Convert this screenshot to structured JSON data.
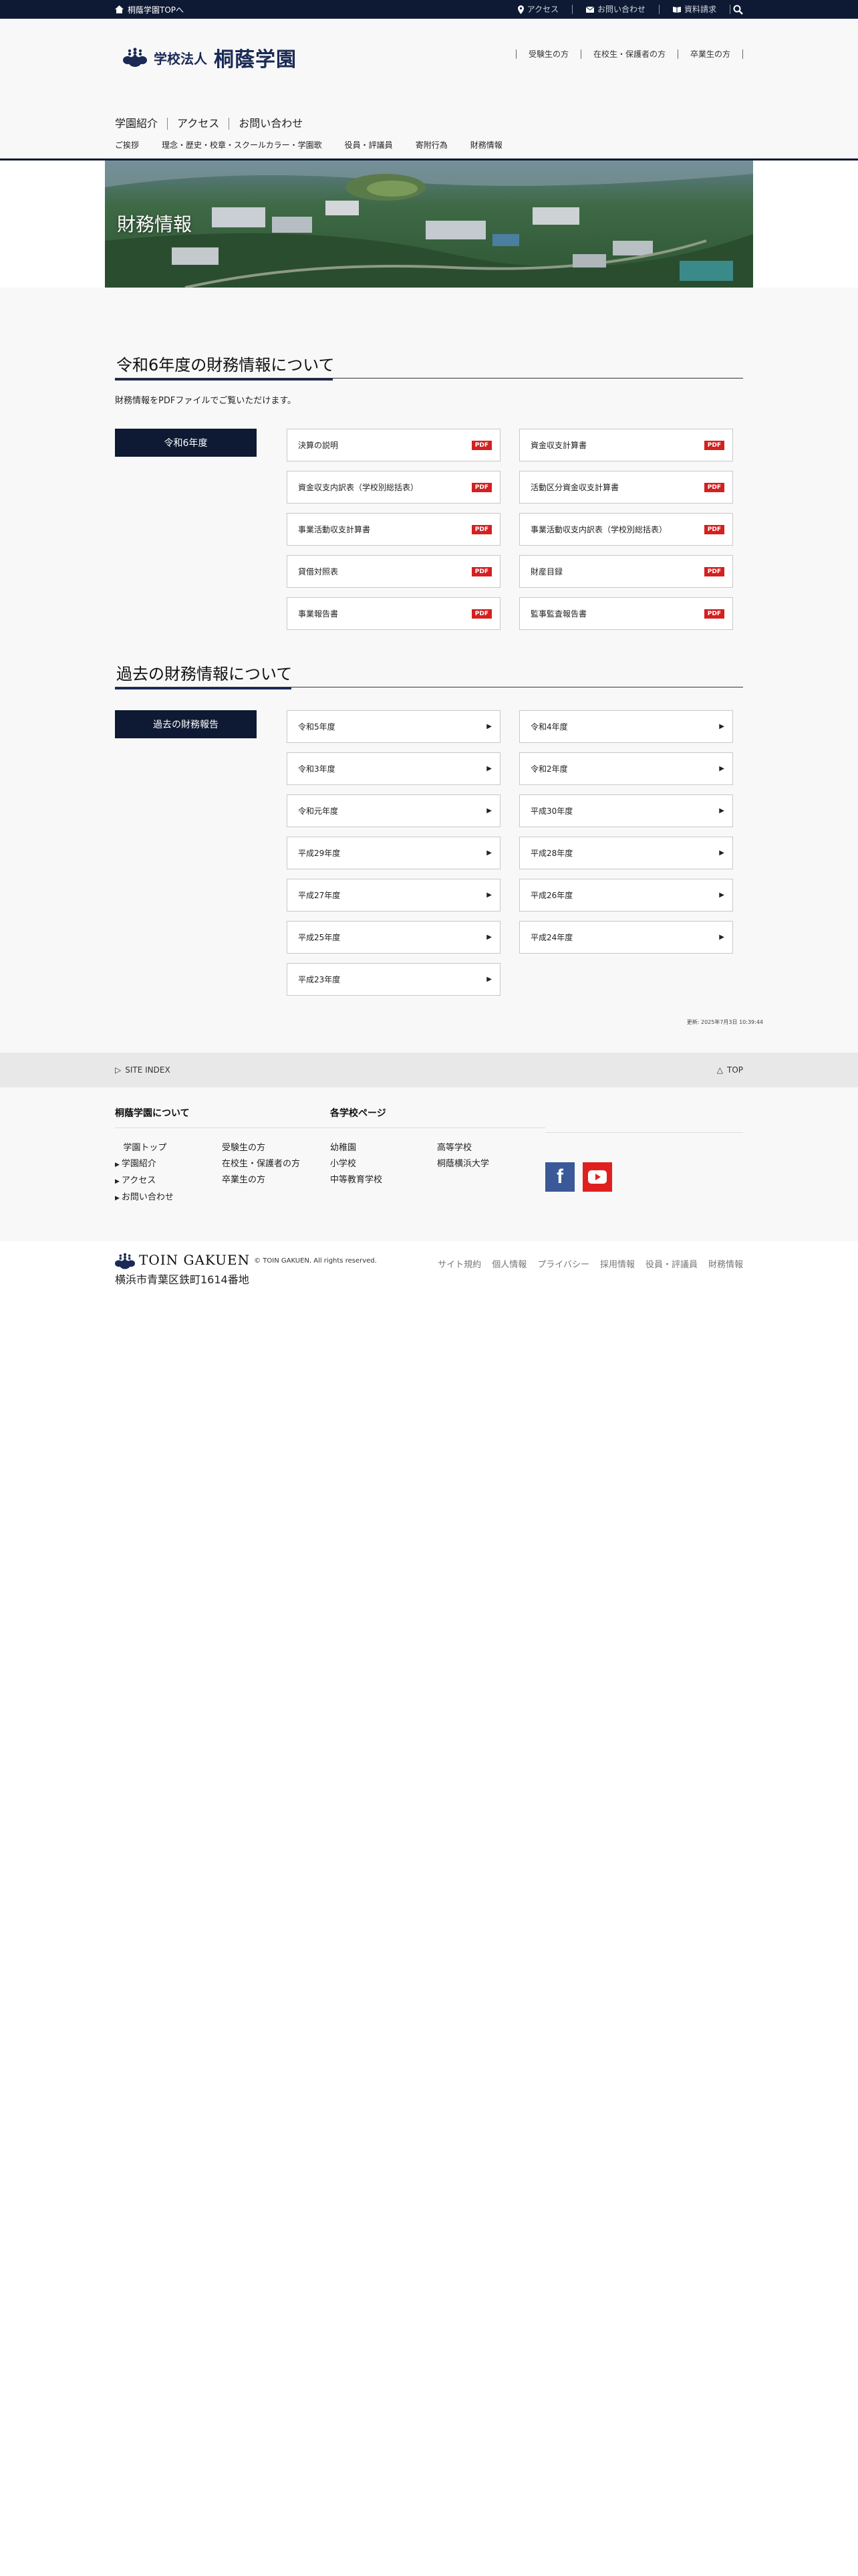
{
  "topbar": {
    "home_label": "桐蔭学園TOPへ",
    "utils": [
      {
        "label": "アクセス",
        "icon": "pin-icon"
      },
      {
        "label": "お問い合わせ",
        "icon": "mail-icon"
      },
      {
        "label": "資料請求",
        "icon": "book-icon"
      }
    ]
  },
  "header": {
    "logo_small": "学校法人",
    "logo_big": "桐蔭学園",
    "audience": [
      "受験生の方",
      "在校生・保護者の方",
      "卒業生の方"
    ],
    "mainnav": [
      "学園紹介",
      "アクセス",
      "お問い合わせ"
    ],
    "subnav": [
      "ご挨拶",
      "理念・歴史・校章・スクールカラー・学園歌",
      "役員・評議員",
      "寄附行為",
      "財務情報"
    ]
  },
  "hero": {
    "title": "財務情報"
  },
  "current": {
    "title": "令和6年度の財務情報について",
    "lead": "財務情報をPDFファイルでご覧いただけます。",
    "label": "令和6年度",
    "pdf_badge": "PDF",
    "docs": [
      "決算の説明",
      "資金収支計算書",
      "資金収支内訳表（学校別総括表）",
      "活動区分資金収支計算書",
      "事業活動収支計算書",
      "事業活動収支内訳表（学校別総括表）",
      "貸借対照表",
      "財産目録",
      "事業報告書",
      "監事監査報告書"
    ]
  },
  "past": {
    "title": "過去の財務情報について",
    "label": "過去の財務報告",
    "years": [
      "令和5年度",
      "令和4年度",
      "令和3年度",
      "令和2年度",
      "令和元年度",
      "平成30年度",
      "平成29年度",
      "平成28年度",
      "平成27年度",
      "平成26年度",
      "平成25年度",
      "平成24年度",
      "平成23年度"
    ]
  },
  "updated": "更新: 2025年7月3日 10:39:44",
  "sitebar": {
    "index_label": "SITE INDEX",
    "top_label": "TOP"
  },
  "footer": {
    "about_title": "桐蔭学園について",
    "about_col1": [
      "学園トップ",
      "学園紹介",
      "アクセス",
      "お問い合わせ"
    ],
    "about_col2": [
      "受験生の方",
      "在校生・保護者の方",
      "卒業生の方"
    ],
    "schools_title": "各学校ページ",
    "schools_col1": [
      "幼稚園",
      "小学校",
      "中等教育学校"
    ],
    "schools_col2": [
      "高等学校",
      "桐蔭横浜大学"
    ]
  },
  "bottom": {
    "brand": "TOIN GAKUEN",
    "copyright": "© TOIN GAKUEN. All rights reserved.",
    "address": "横浜市青葉区鉄町1614番地",
    "links": [
      "サイト規約",
      "個人情報",
      "プライバシー",
      "採用情報",
      "役員・評議員",
      "財務情報"
    ]
  },
  "colors": {
    "navy": "#0e1a33",
    "accent": "#1a2a55",
    "pdf": "#d42020"
  }
}
